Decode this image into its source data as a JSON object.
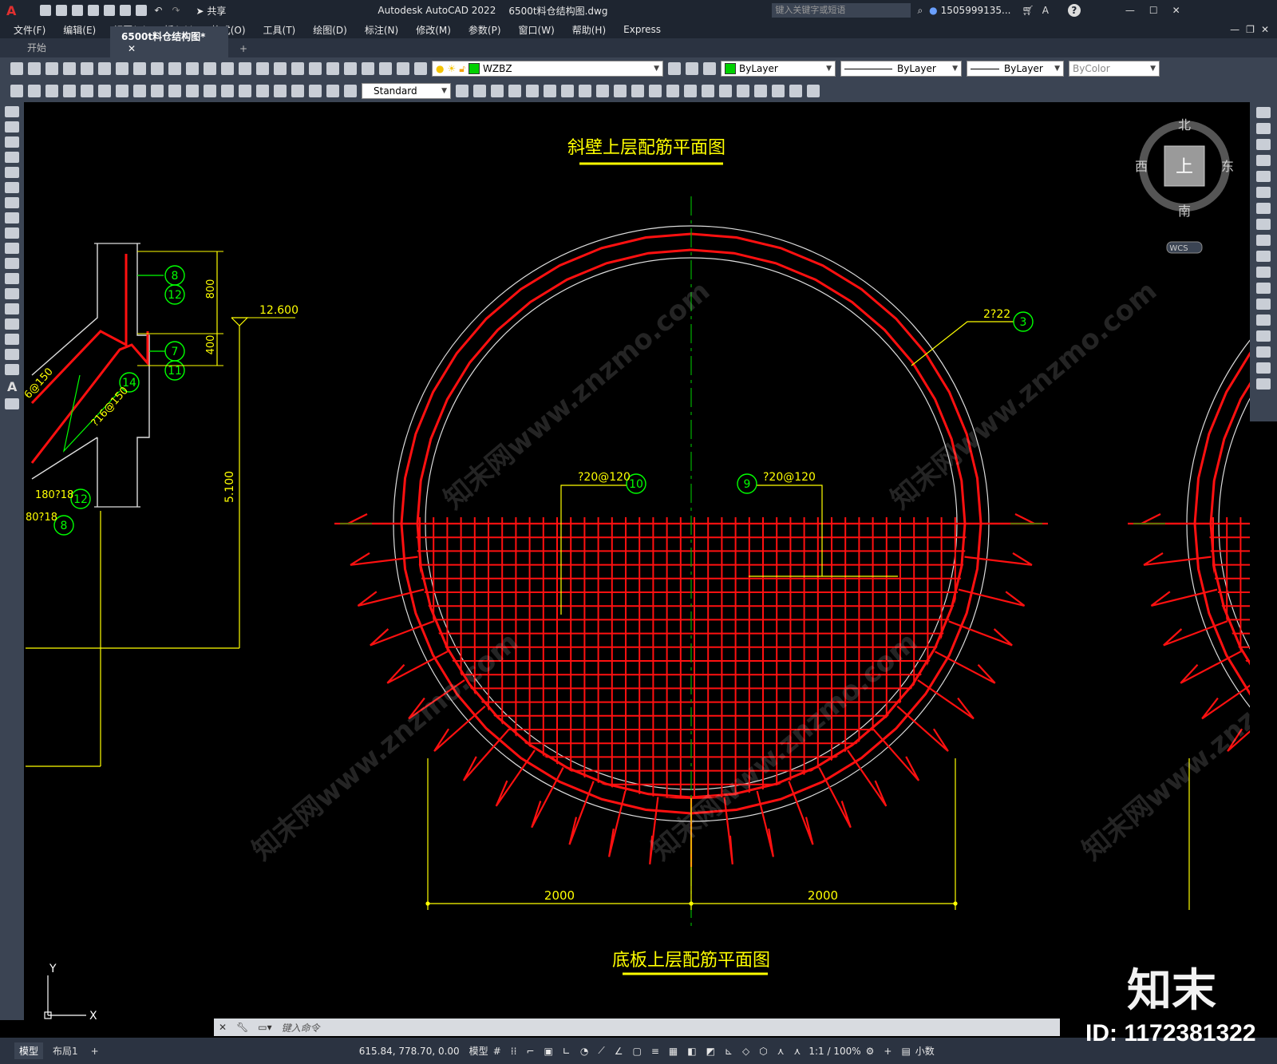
{
  "window": {
    "app_title": "Autodesk AutoCAD 2022",
    "file_title": "6500t料仓结构图.dwg",
    "share_label": "共享",
    "search_placeholder": "键入关键字或短语",
    "user": "1505999135...",
    "help": "?"
  },
  "menu": [
    "文件(F)",
    "编辑(E)",
    "视图(V)",
    "插入(I)",
    "格式(O)",
    "工具(T)",
    "绘图(D)",
    "标注(N)",
    "修改(M)",
    "参数(P)",
    "窗口(W)",
    "帮助(H)",
    "Express"
  ],
  "tabs": [
    {
      "label": "开始",
      "active": false
    },
    {
      "label": "6500t料仓结构图*",
      "active": true
    }
  ],
  "toolbar": {
    "layer": "WZBZ",
    "color": "ByLayer",
    "linetype": "ByLayer",
    "lineweight": "ByLayer",
    "plotstyle": "ByColor",
    "textstyle": "Standard"
  },
  "viewcube": {
    "north": "北",
    "south": "南",
    "east": "东",
    "west": "西",
    "face": "上",
    "wcs": "WCS"
  },
  "drawing": {
    "title_top": "斜壁上层配筋平面图",
    "title_bottom": "底板上层配筋平面图",
    "dim_left": "2000",
    "dim_right": "2000",
    "callout_10_text": "?20@120",
    "callout_10_num": "10",
    "callout_9_text": "?20@120",
    "callout_9_num": "9",
    "callout_3_text": "2?22",
    "callout_3_num": "3",
    "section": {
      "b8": "8",
      "b12": "12",
      "b7": "7",
      "b11": "11",
      "b14": "14",
      "b12b": "12",
      "b8b": "8",
      "dim_800": "800",
      "dim_400": "400",
      "elev": "12.600",
      "dim_5100": "5.100",
      "t1": "180?18",
      "t2": "80?18",
      "t3": "?16@150",
      "t4": "6@150"
    }
  },
  "ucs": {
    "x": "X",
    "y": "Y"
  },
  "watermark": {
    "logo": "知末",
    "id": "ID: 1172381322",
    "site": "知末网www.znzmo.com"
  },
  "command": {
    "placeholder": "键入命令"
  },
  "layout_tabs": [
    "模型",
    "布局1"
  ],
  "status": {
    "coords": "615.84, 778.70, 0.00",
    "mode": "模型",
    "scale": "1:1 / 100%",
    "units": "小数"
  }
}
